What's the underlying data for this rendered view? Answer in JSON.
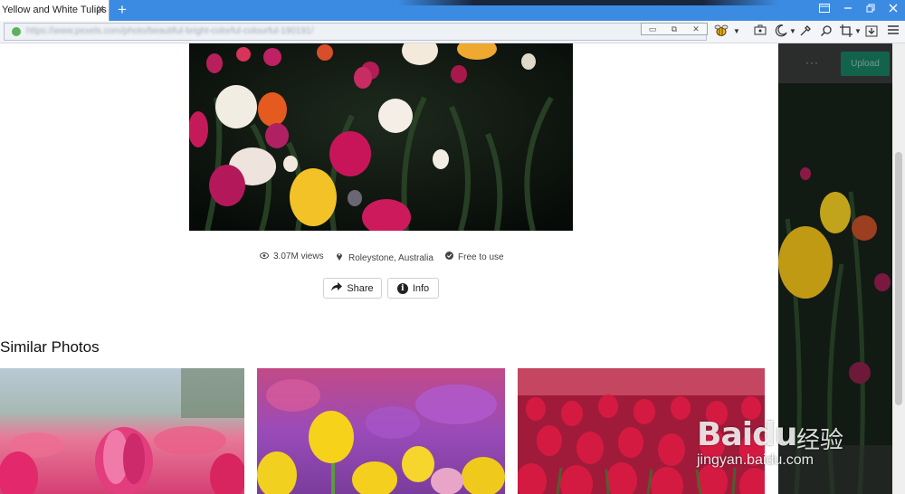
{
  "browser": {
    "tab_title": "Yellow and White Tulips",
    "tab_close": "✕",
    "new_tab": "+",
    "address_url": "https://www.pexels.com/photo/beautiful-bright-colorful-colourful-190191/",
    "addr_btn_min": "▭",
    "addr_btn_restore": "⧉",
    "addr_btn_close": "✕",
    "icons": [
      "bee-icon",
      "briefcase-icon",
      "moon-icon",
      "tools-icon",
      "search-icon",
      "crop-icon",
      "download-icon",
      "menu-icon"
    ],
    "window_controls": [
      "skin-icon",
      "minimize-icon",
      "restore-icon",
      "close-icon"
    ]
  },
  "photo": {
    "views": "3.07M views",
    "location": "Roleystone, Australia",
    "license": "Free to use",
    "share_label": "Share",
    "info_label": "Info"
  },
  "similar": {
    "title": "Similar Photos"
  },
  "side_panel": {
    "upload_label": "Upload",
    "more_label": "···"
  },
  "watermark": {
    "logo": "Baidu",
    "logo_cn": "经验",
    "url": "jingyan.baidu.com"
  },
  "colors": {
    "chrome_blue": "#3b8be3",
    "accent_green": "#0a7a5a"
  }
}
